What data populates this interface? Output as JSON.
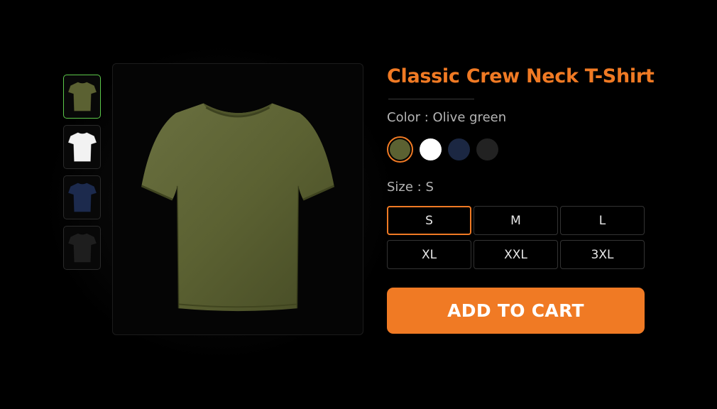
{
  "product": {
    "title": "Classic Crew Neck T-Shirt"
  },
  "color": {
    "label": "Color : ",
    "selected": "Olive green",
    "swatches": [
      {
        "name": "Olive green",
        "hex": "#5b6132",
        "selected": true
      },
      {
        "name": "White",
        "hex": "#ffffff",
        "selected": false
      },
      {
        "name": "Navy",
        "hex": "#1b2742",
        "selected": false
      },
      {
        "name": "Black",
        "hex": "#222222",
        "selected": false
      }
    ]
  },
  "size": {
    "label": "Size : ",
    "selected": "S",
    "options": [
      "S",
      "M",
      "L",
      "XL",
      "XXL",
      "3XL"
    ]
  },
  "thumbnails": [
    {
      "color": "#5b6132",
      "icon": "tshirt-olive-icon",
      "active": true
    },
    {
      "color": "#f2f2f2",
      "icon": "tshirt-white-icon",
      "active": false
    },
    {
      "color": "#1c2a4d",
      "icon": "tshirt-navy-icon",
      "active": false
    },
    {
      "color": "#1e1e1e",
      "icon": "tshirt-black-icon",
      "active": false
    }
  ],
  "main_image": {
    "color": "#5b6132",
    "icon": "tshirt-icon"
  },
  "cart": {
    "label": "ADD TO CART"
  },
  "colors": {
    "accent": "#f07a24",
    "thumb_active_border": "#5cc84a"
  }
}
